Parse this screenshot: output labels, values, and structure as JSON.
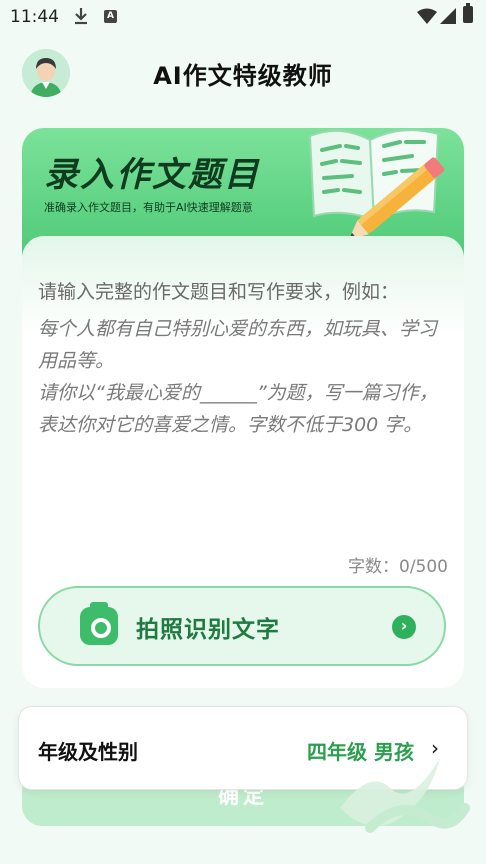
{
  "status_bar": {
    "time": "11:44",
    "icons": [
      "download-icon",
      "a-app-icon",
      "wifi-icon",
      "signal-icon",
      "battery-icon"
    ]
  },
  "header": {
    "title": "AI作文特级教师"
  },
  "banner": {
    "title": "录入作文题目",
    "subtitle": "准确录入作文题目，有助于AI快速理解题意"
  },
  "input": {
    "prompt": "请输入完整的作文题目和写作要求，例如：",
    "example": "每个人都有自己特别心爱的东西，如玩具、学习用品等。\n请你以“我最心爱的______”为题，写一篇习作，表达你对它的喜爱之情。字数不低于300 字。",
    "counter": "字数：0/500"
  },
  "ocr_button": {
    "label": "拍照识别文字"
  },
  "grade": {
    "label": "年级及性别",
    "value": "四年级 男孩"
  },
  "confirm_button": {
    "label": "确定"
  },
  "colors": {
    "accent": "#2fb15c",
    "banner": "#5dd182",
    "background": "#f1faf5"
  }
}
